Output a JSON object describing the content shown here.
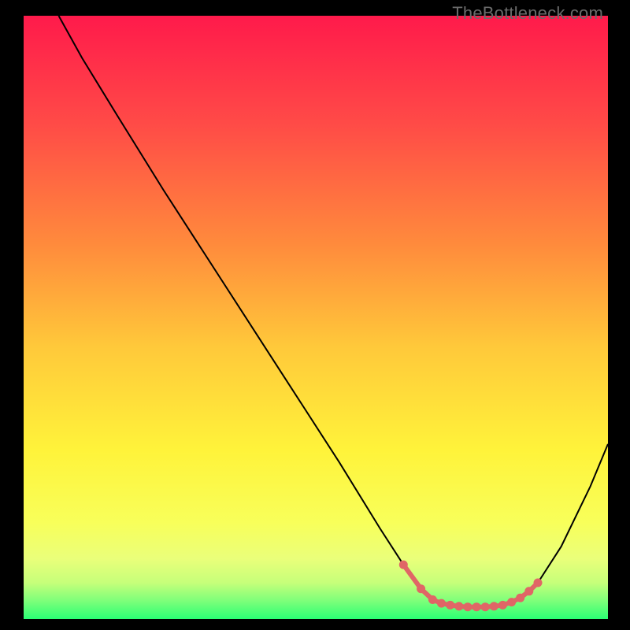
{
  "watermark": "TheBottleneck.com",
  "chart_data": {
    "type": "line",
    "title": "",
    "xlabel": "",
    "ylabel": "",
    "xlim": [
      0,
      100
    ],
    "ylim": [
      0,
      100
    ],
    "gradient_stops": [
      {
        "offset": 0,
        "color": "#ff1a4b"
      },
      {
        "offset": 18,
        "color": "#ff4b47"
      },
      {
        "offset": 38,
        "color": "#ff8b3c"
      },
      {
        "offset": 55,
        "color": "#ffc93a"
      },
      {
        "offset": 72,
        "color": "#fff33a"
      },
      {
        "offset": 84,
        "color": "#f8ff5a"
      },
      {
        "offset": 90,
        "color": "#eaff7a"
      },
      {
        "offset": 94,
        "color": "#c6ff7a"
      },
      {
        "offset": 97,
        "color": "#7dff7a"
      },
      {
        "offset": 100,
        "color": "#2bff74"
      }
    ],
    "series": [
      {
        "name": "curve",
        "color": "#000000",
        "points": [
          {
            "x": 6.0,
            "y": 100.0
          },
          {
            "x": 10.0,
            "y": 93.0
          },
          {
            "x": 16.0,
            "y": 83.5
          },
          {
            "x": 24.0,
            "y": 71.0
          },
          {
            "x": 34.0,
            "y": 56.0
          },
          {
            "x": 44.0,
            "y": 41.0
          },
          {
            "x": 54.0,
            "y": 26.0
          },
          {
            "x": 61.0,
            "y": 15.0
          },
          {
            "x": 65.0,
            "y": 9.0
          },
          {
            "x": 68.0,
            "y": 5.0
          },
          {
            "x": 70.0,
            "y": 3.2
          },
          {
            "x": 73.0,
            "y": 2.3
          },
          {
            "x": 76.0,
            "y": 2.0
          },
          {
            "x": 79.0,
            "y": 2.0
          },
          {
            "x": 82.0,
            "y": 2.3
          },
          {
            "x": 85.0,
            "y": 3.5
          },
          {
            "x": 88.0,
            "y": 6.0
          },
          {
            "x": 92.0,
            "y": 12.0
          },
          {
            "x": 97.0,
            "y": 22.0
          },
          {
            "x": 100.0,
            "y": 29.0
          }
        ]
      },
      {
        "name": "optimal-range-marker",
        "color": "#e06666",
        "points": [
          {
            "x": 65.0,
            "y": 9.0
          },
          {
            "x": 68.0,
            "y": 5.0
          },
          {
            "x": 70.0,
            "y": 3.2
          },
          {
            "x": 71.5,
            "y": 2.6
          },
          {
            "x": 73.0,
            "y": 2.3
          },
          {
            "x": 74.5,
            "y": 2.1
          },
          {
            "x": 76.0,
            "y": 2.0
          },
          {
            "x": 77.5,
            "y": 2.0
          },
          {
            "x": 79.0,
            "y": 2.0
          },
          {
            "x": 80.5,
            "y": 2.1
          },
          {
            "x": 82.0,
            "y": 2.3
          },
          {
            "x": 83.5,
            "y": 2.8
          },
          {
            "x": 85.0,
            "y": 3.5
          },
          {
            "x": 86.5,
            "y": 4.6
          },
          {
            "x": 88.0,
            "y": 6.0
          }
        ]
      }
    ]
  }
}
